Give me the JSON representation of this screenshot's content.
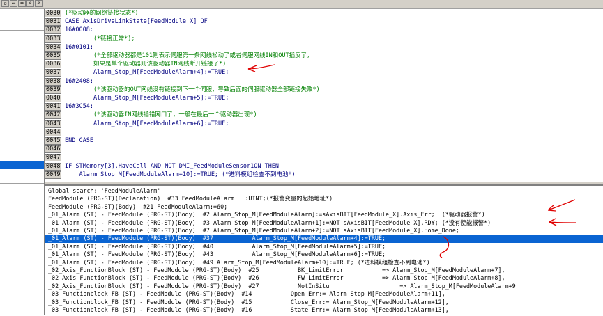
{
  "toolbar": {
    "buttons": [
      {
        "name": "new-file-icon"
      },
      {
        "name": "open-file-icon"
      },
      {
        "name": "binoculars-icon"
      },
      {
        "name": "find-next-icon"
      },
      {
        "name": "find-replace-icon"
      }
    ]
  },
  "code_lines": [
    {
      "no": "0030",
      "text": "(*驱动器的网络链接状态*)",
      "style": "comment"
    },
    {
      "no": "0031",
      "text": "CASE AxisDriveLinkState[FeedModule_X] OF",
      "style": "code"
    },
    {
      "no": "0032",
      "text": "16#0008:",
      "style": "code"
    },
    {
      "no": "0033",
      "text": "        (*链接正常*);",
      "style": "comment"
    },
    {
      "no": "0034",
      "text": "16#0101:",
      "style": "code"
    },
    {
      "no": "0035",
      "text": "        (*全部驱动器都是101则表示伺服第一条网线松动了或者伺服网线IN和OUT插反了，",
      "style": "comment"
    },
    {
      "no": "0036",
      "text": "        如果是单个驱动器则该驱动器IN网线断开链接了*)",
      "style": "comment"
    },
    {
      "no": "0037",
      "text": "        Alarm_Stop_M[FeedModuleAlarm+4]:=TRUE;",
      "style": "code"
    },
    {
      "no": "0038",
      "text": "16#2408:",
      "style": "code"
    },
    {
      "no": "0039",
      "text": "        (*该驱动器的OUT网线没有链接到下一个伺服，导致后面的伺服驱动器全部链接失败*)",
      "style": "comment"
    },
    {
      "no": "0040",
      "text": "        Alarm_Stop_M[FeedModuleAlarm+5]:=TRUE;",
      "style": "code"
    },
    {
      "no": "0041",
      "text": "16#3C54:",
      "style": "code"
    },
    {
      "no": "0042",
      "text": "        (*该驱动器IN网线插错网口了，一般在最后一个驱动器出现*)",
      "style": "comment"
    },
    {
      "no": "0043",
      "text": "        Alarm_Stop_M[FeedModuleAlarm+6]:=TRUE;",
      "style": "code"
    },
    {
      "no": "0044",
      "text": "",
      "style": "code"
    },
    {
      "no": "0045",
      "text": "END_CASE",
      "style": "code"
    },
    {
      "no": "0046",
      "text": "",
      "style": "code"
    },
    {
      "no": "0047",
      "text": "",
      "style": "code"
    },
    {
      "no": "0048",
      "text": "IF STMemory[3].HaveCell AND NOT DMI_FeedModuleSensor1ON THEN",
      "style": "code"
    },
    {
      "no": "0049",
      "text": "    Alarm Stop M[FeedModuleAlarm+10]:=TRUE; (*进料模组检查不到电池*)",
      "style": "code"
    }
  ],
  "results": [
    "Global search: 'FeedModuleAlarm'",
    "FeedModule (PRG-ST)(Declaration)  #33 FeedModuleAlarm   :UINT;(*报警变量的起始地址*)",
    "FeedModule (PRG-ST)(Body)  #21 FeedModuleAlarm:=60;",
    "_01_Alarm (ST) - FeedModule (PRG-ST)(Body)  #2 Alarm_Stop_M[FeedModuleAlarm]:=sAxisBIT[FeedModule_X].Axis_Err;  (*驱动器报警*)",
    "_01_Alarm (ST) - FeedModule (PRG-ST)(Body)  #3 Alarm_Stop_M[FeedModuleAlarm+1]:=NOT sAxisBIT[FeedModule_X].RDY; (*没有使能报警*)",
    "_01_Alarm (ST) - FeedModule (PRG-ST)(Body)  #7 Alarm_Stop_M[FeedModuleAlarm+2]:=NOT sAxisBIT[FeedModule_X].Home_Done;",
    "_01_Alarm (ST) - FeedModule (PRG-ST)(Body)  #37           Alarm_Stop_M[FeedModuleAlarm+4]:=TRUE;",
    "_01_Alarm (ST) - FeedModule (PRG-ST)(Body)  #40           Alarm_Stop_M[FeedModuleAlarm+5]:=TRUE;",
    "_01_Alarm (ST) - FeedModule (PRG-ST)(Body)  #43           Alarm_Stop_M[FeedModuleAlarm+6]:=TRUE;",
    "_01_Alarm (ST) - FeedModule (PRG-ST)(Body)  #49 Alarm_Stop_M[FeedModuleAlarm+10]:=TRUE; (*进料模组检查不到电池*)",
    "_02_Axis_FunctionBlock (ST) - FeedModule (PRG-ST)(Body)  #25           BK_LimitError           => Alarm_Stop_M[FeedModuleAlarm+7],",
    "_02_Axis_FunctionBlock (ST) - FeedModule (PRG-ST)(Body)  #26           FW_LimitError           => Alarm_Stop_M[FeedModuleAlarm+8],",
    "_02_Axis_FunctionBlock (ST) - FeedModule (PRG-ST)(Body)  #27           NotInSitu                    => Alarm_Stop_M[FeedModuleAlarm+9",
    "_03_Functionblock_FB (ST) - FeedModule (PRG-ST)(Body)  #14           Open_Err:= Alarm_Stop_M[FeedModuleAlarm+11],",
    "_03_Functionblock_FB (ST) - FeedModule (PRG-ST)(Body)  #15           Close_Err:= Alarm_Stop_M[FeedModuleAlarm+12],",
    "_03_Functionblock_FB (ST) - FeedModule (PRG-ST)(Body)  #16           State_Err:= Alarm_Stop_M[FeedModuleAlarm+13],"
  ],
  "selected_result_index": 6,
  "colors": {
    "keyword": "#000080",
    "comment": "#008000",
    "selection": "#0a64d2",
    "annotation": "#e00000"
  }
}
